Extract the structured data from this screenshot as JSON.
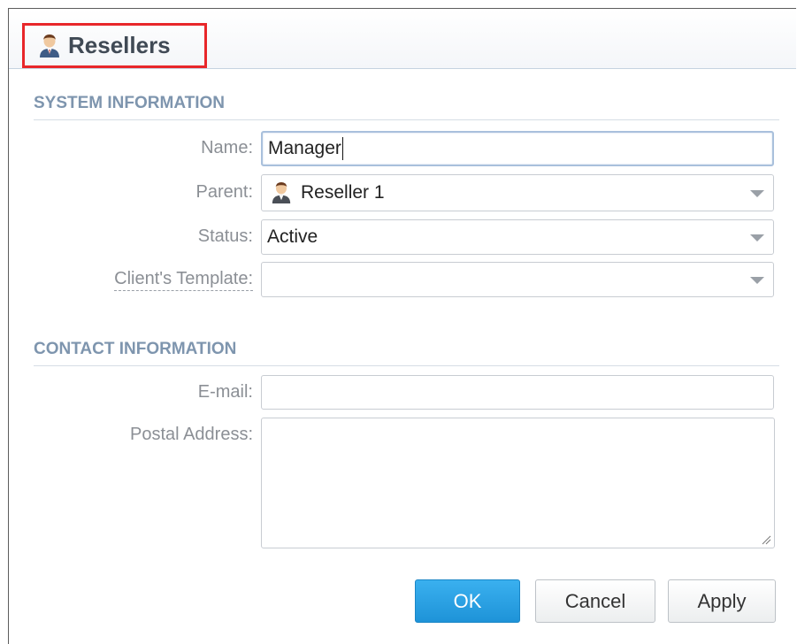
{
  "header": {
    "title": "Resellers",
    "icon": "reseller-user-icon"
  },
  "system_section": {
    "title": "SYSTEM INFORMATION",
    "name_label": "Name:",
    "name_value": "Manager",
    "parent_label": "Parent:",
    "parent_value": "Reseller 1",
    "parent_icon": "reseller-user-icon",
    "status_label": "Status:",
    "status_value": "Active",
    "template_label": "Client's Template:",
    "template_value": ""
  },
  "contact_section": {
    "title": "CONTACT INFORMATION",
    "email_label": "E-mail:",
    "email_value": "",
    "address_label": "Postal Address:",
    "address_value": ""
  },
  "buttons": {
    "ok": "OK",
    "cancel": "Cancel",
    "apply": "Apply"
  },
  "colors": {
    "accent": "#1e93d8",
    "highlight_border": "#e8262a",
    "section_title": "#7e95ae"
  }
}
